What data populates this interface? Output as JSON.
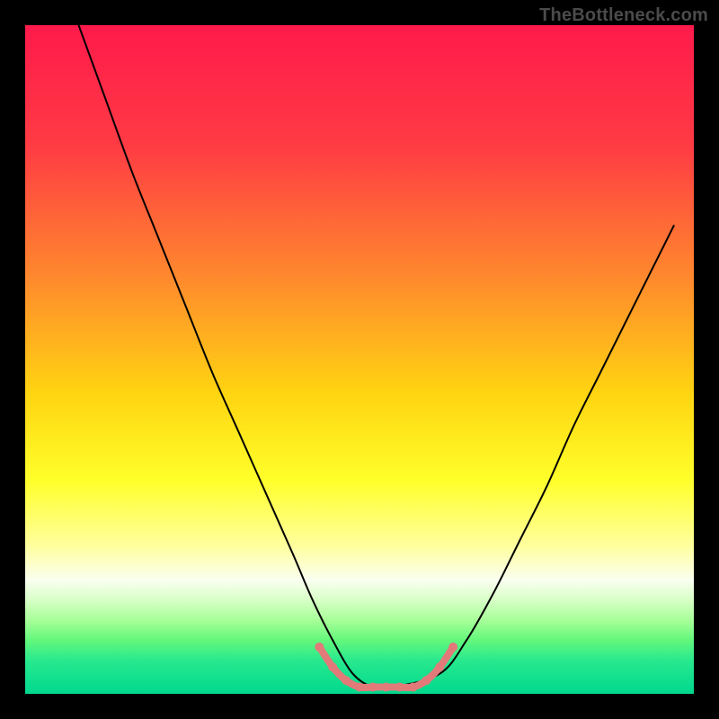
{
  "watermark": "TheBottleneck.com",
  "chart_data": {
    "type": "line",
    "title": "",
    "xlabel": "",
    "ylabel": "",
    "xlim": [
      0,
      100
    ],
    "ylim": [
      0,
      100
    ],
    "gradient_stops": [
      {
        "offset": 0,
        "color": "#ff1a4b"
      },
      {
        "offset": 18,
        "color": "#ff3b44"
      },
      {
        "offset": 38,
        "color": "#ff8a2d"
      },
      {
        "offset": 55,
        "color": "#ffd411"
      },
      {
        "offset": 68,
        "color": "#ffff2a"
      },
      {
        "offset": 78,
        "color": "#ffffa0"
      },
      {
        "offset": 83,
        "color": "#fafff0"
      },
      {
        "offset": 86,
        "color": "#d7ffc6"
      },
      {
        "offset": 89,
        "color": "#a7ff98"
      },
      {
        "offset": 92,
        "color": "#63f77c"
      },
      {
        "offset": 95,
        "color": "#28e98e"
      },
      {
        "offset": 100,
        "color": "#00d88e"
      }
    ],
    "series": [
      {
        "name": "bottleneck-curve",
        "color": "#000000",
        "width": 2.0,
        "x": [
          8,
          12,
          16,
          20,
          24,
          28,
          32,
          36,
          40,
          43,
          46,
          49,
          52,
          55,
          62,
          66,
          70,
          74,
          78,
          82,
          86,
          90,
          94,
          97
        ],
        "values": [
          100,
          89,
          78,
          68,
          58,
          48,
          39,
          30,
          21,
          14,
          8,
          3,
          1,
          1,
          3,
          8,
          15,
          23,
          31,
          40,
          48,
          56,
          64,
          70
        ]
      },
      {
        "name": "sweet-spot-band",
        "color": "#e37a7a",
        "width": 8,
        "x": [
          44,
          46,
          48,
          50,
          52,
          54,
          56,
          58,
          60,
          62,
          64
        ],
        "values": [
          7,
          4,
          2,
          1,
          1,
          1,
          1,
          1,
          2,
          4,
          7
        ]
      }
    ],
    "markers": {
      "name": "sweet-spot-dots",
      "color": "#e37a7a",
      "radius": 5,
      "x": [
        44,
        46,
        48,
        50,
        52,
        54,
        56,
        58,
        60,
        62,
        64
      ],
      "values": [
        7,
        4,
        2,
        1,
        1,
        1,
        1,
        1,
        2,
        4,
        7
      ]
    }
  }
}
